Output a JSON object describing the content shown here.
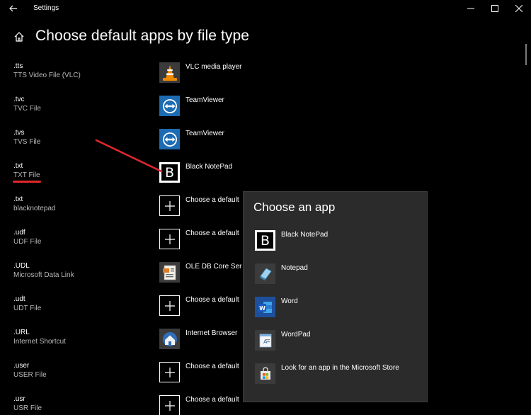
{
  "window": {
    "title": "Settings",
    "controls": [
      "minimize",
      "maximize",
      "close"
    ]
  },
  "header": {
    "title": "Choose default apps by file type",
    "home_icon": "home-icon",
    "back_icon": "back-arrow-icon"
  },
  "rows": [
    {
      "ext": ".tts",
      "description": "TTS Video File (VLC)",
      "app": "VLC media player",
      "icon": "vlc-icon"
    },
    {
      "ext": ".tvc",
      "description": "TVC File",
      "app": "TeamViewer",
      "icon": "teamviewer-icon"
    },
    {
      "ext": ".tvs",
      "description": "TVS File",
      "app": "TeamViewer",
      "icon": "teamviewer-icon"
    },
    {
      "ext": ".txt",
      "description": "TXT File",
      "app": "Black NotePad",
      "icon": "black-notepad-icon"
    },
    {
      "ext": ".txt",
      "description": "blacknotepad",
      "app": "Choose a default",
      "icon": "plus-icon"
    },
    {
      "ext": ".udf",
      "description": "UDF File",
      "app": "Choose a default",
      "icon": "plus-icon"
    },
    {
      "ext": ".UDL",
      "description": "Microsoft Data Link",
      "app": "OLE DB Core Ser",
      "icon": "ole-db-icon"
    },
    {
      "ext": ".udt",
      "description": "UDT File",
      "app": "Choose a default",
      "icon": "plus-icon"
    },
    {
      "ext": ".URL",
      "description": "Internet Shortcut",
      "app": "Internet Browser",
      "icon": "internet-browser-icon"
    },
    {
      "ext": ".user",
      "description": "USER File",
      "app": "Choose a default",
      "icon": "plus-icon"
    },
    {
      "ext": ".usr",
      "description": "USR File",
      "app": "Choose a default",
      "icon": "plus-icon"
    }
  ],
  "flyout": {
    "title": "Choose an app",
    "items": [
      {
        "label": "Black NotePad",
        "icon": "black-notepad-icon"
      },
      {
        "label": "Notepad",
        "icon": "notepad-icon"
      },
      {
        "label": "Word",
        "icon": "word-icon"
      },
      {
        "label": "WordPad",
        "icon": "wordpad-icon"
      },
      {
        "label": "Look for an app in the Microsoft Store",
        "icon": "microsoft-store-icon"
      }
    ]
  },
  "colors": {
    "background": "#000000",
    "flyout_background": "#2b2b2b",
    "annotation_red": "#e0282c",
    "teamviewer_blue": "#1c6bb3",
    "vlc_orange": "#f08a00"
  }
}
